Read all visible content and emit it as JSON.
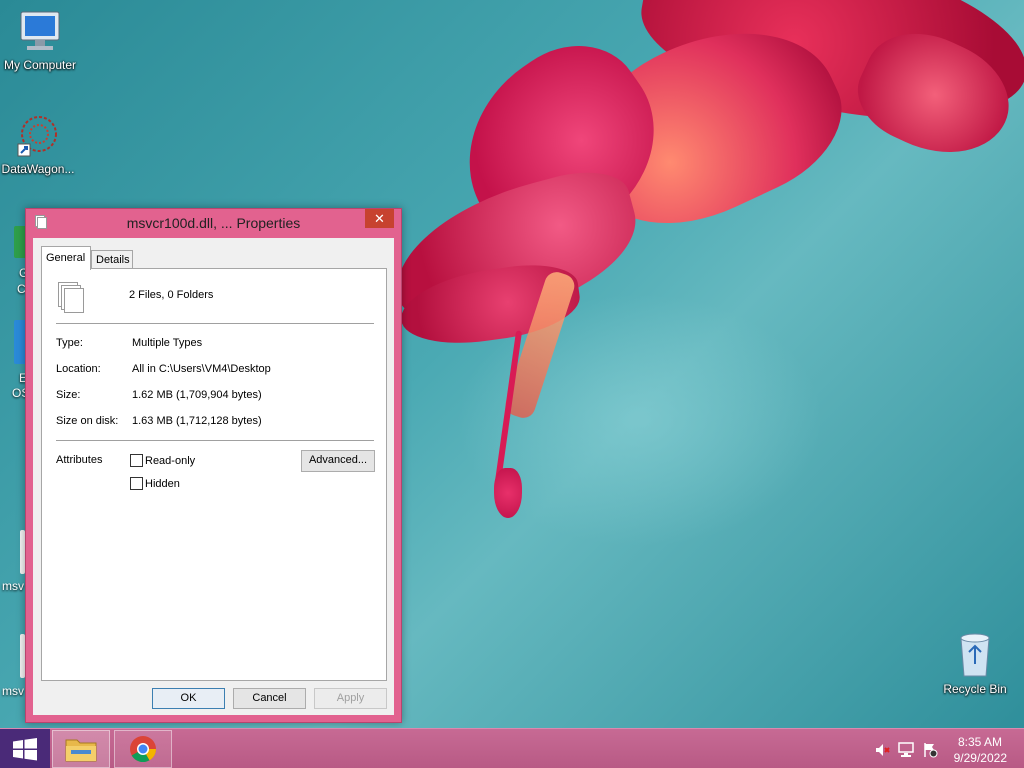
{
  "desktop": {
    "icons": [
      {
        "label": "My Computer",
        "icon": "computer-icon"
      },
      {
        "label": "DataWagon...",
        "icon": "datawagon-icon"
      },
      {
        "label": "Recycle Bin",
        "icon": "recycle-bin-icon"
      }
    ],
    "partial_labels": [
      "G",
      "C",
      "E",
      "OS",
      "msv",
      "msv"
    ]
  },
  "dialog": {
    "title": "msvcr100d.dll, ... Properties",
    "close_glyph": "✕",
    "tabs": [
      {
        "label": "General",
        "active": true
      },
      {
        "label": "Details",
        "active": false
      }
    ],
    "summary": "2 Files, 0 Folders",
    "properties": [
      {
        "label": "Type:",
        "value": "Multiple Types"
      },
      {
        "label": "Location:",
        "value": "All in C:\\Users\\VM4\\Desktop"
      },
      {
        "label": "Size:",
        "value": "1.62 MB (1,709,904 bytes)"
      },
      {
        "label": "Size on disk:",
        "value": "1.63 MB (1,712,128 bytes)"
      }
    ],
    "attributes": {
      "label": "Attributes",
      "read_only": {
        "label": "Read-only",
        "checked": false
      },
      "hidden": {
        "label": "Hidden",
        "checked": false
      },
      "advanced_label": "Advanced..."
    },
    "buttons": {
      "ok": "OK",
      "cancel": "Cancel",
      "apply": "Apply"
    }
  },
  "taskbar": {
    "start": "windows-logo-icon",
    "items": [
      {
        "name": "file-explorer",
        "icon": "folder-icon",
        "active": true
      },
      {
        "name": "chrome",
        "icon": "chrome-icon",
        "active": false
      }
    ],
    "tray": [
      "volume-muted-icon",
      "network-icon",
      "action-center-flag-icon"
    ],
    "time": "8:35 AM",
    "date": "9/29/2022"
  },
  "colors": {
    "dialog_frame": "#e2628f",
    "taskbar": "#c76a94",
    "close_button": "#c7422f",
    "start_button": "#4a2a78"
  }
}
